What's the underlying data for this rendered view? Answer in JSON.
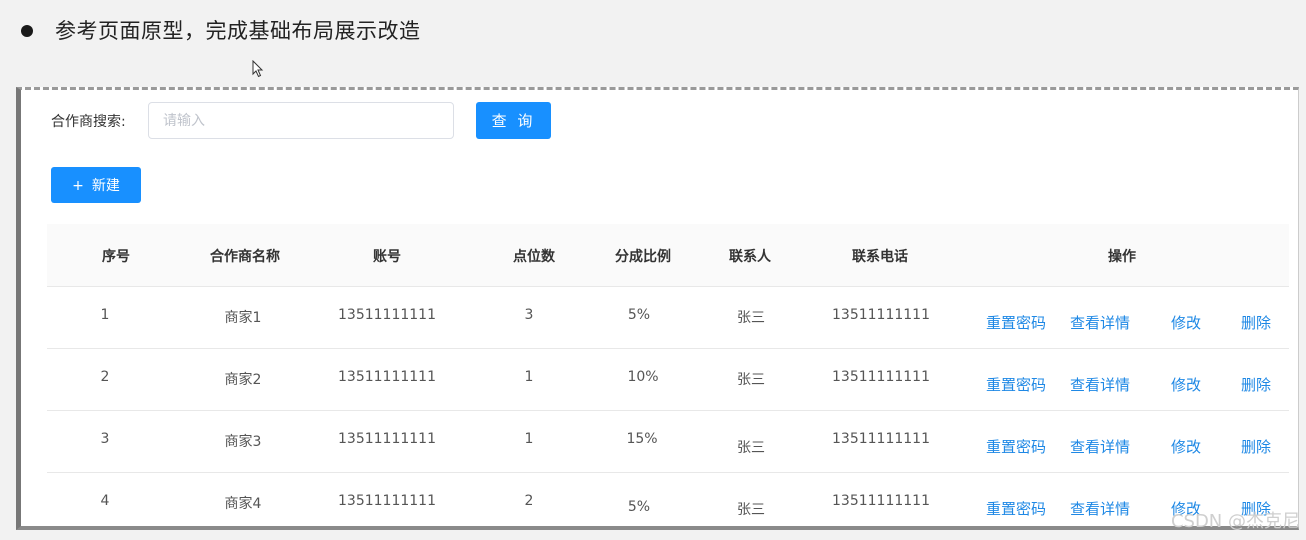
{
  "slide": {
    "title": "参考页面原型，完成基础布局展示改造"
  },
  "search": {
    "label": "合作商搜索:",
    "placeholder": "请输入",
    "value": "",
    "button_label": "查 询"
  },
  "toolbar": {
    "new_icon": "+",
    "new_label": "新建"
  },
  "table": {
    "columns": [
      "序号",
      "合作商名称",
      "账号",
      "点位数",
      "分成比例",
      "联系人",
      "联系电话",
      "操作"
    ],
    "actions": [
      "重置密码",
      "查看详情",
      "修改",
      "删除"
    ],
    "rows": [
      {
        "index": "1",
        "name": "商家1",
        "account": "13511111111",
        "points": "3",
        "ratio": "5%",
        "contact": "张三",
        "phone": "13511111111"
      },
      {
        "index": "2",
        "name": "商家2",
        "account": "13511111111",
        "points": "1",
        "ratio": "10%",
        "contact": "张三",
        "phone": "13511111111"
      },
      {
        "index": "3",
        "name": "商家3",
        "account": "13511111111",
        "points": "1",
        "ratio": "15%",
        "contact": "张三",
        "phone": "13511111111"
      },
      {
        "index": "4",
        "name": "商家4",
        "account": "13511111111",
        "points": "2",
        "ratio": "5%",
        "contact": "张三",
        "phone": "13511111111"
      }
    ]
  },
  "watermark": "CSDN @杰克尼"
}
